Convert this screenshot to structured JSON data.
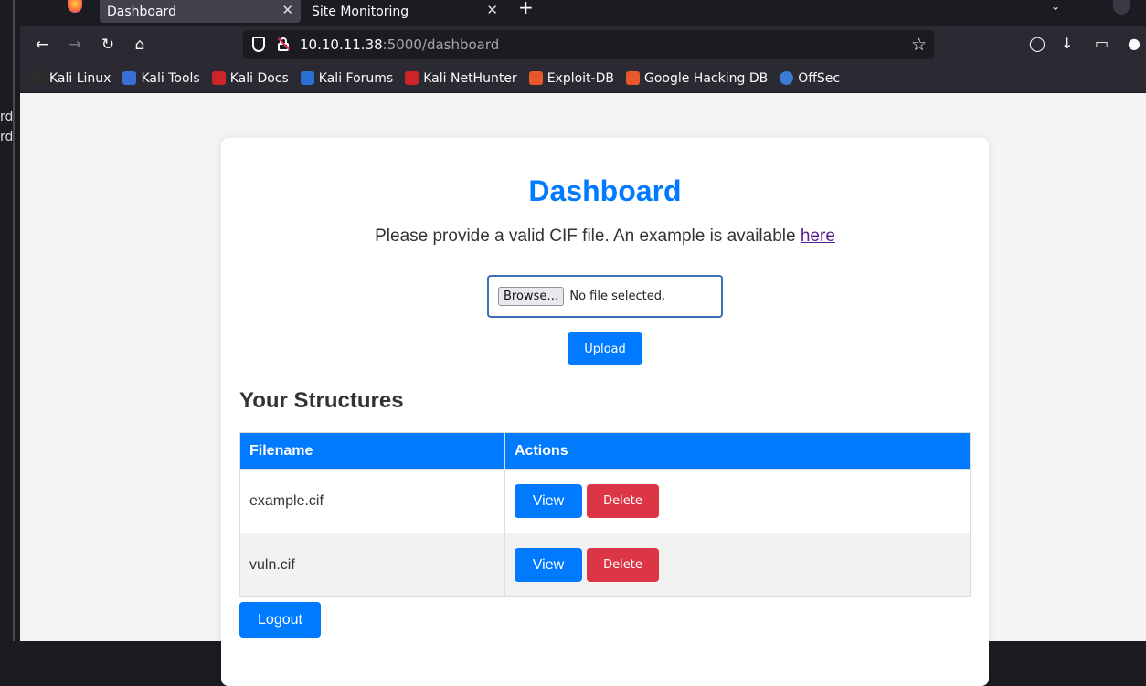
{
  "browser": {
    "tabs": [
      {
        "label": "Dashboard",
        "active": true
      },
      {
        "label": "Site Monitoring",
        "active": false
      }
    ],
    "tab_close_glyph": "✕",
    "new_tab_glyph": "+",
    "url_host": "10.10.11.38",
    "url_rest": ":5000/dashboard",
    "bookmarks": [
      {
        "label": "Kali Linux",
        "color": "#2c2c2c"
      },
      {
        "label": "Kali Tools",
        "color": "#3b6fd8"
      },
      {
        "label": "Kali Docs",
        "color": "#d0242b"
      },
      {
        "label": "Kali Forums",
        "color": "#2a6fd6"
      },
      {
        "label": "Kali NetHunter",
        "color": "#d0242b"
      },
      {
        "label": "Exploit-DB",
        "color": "#e8582a"
      },
      {
        "label": "Google Hacking DB",
        "color": "#e8582a"
      },
      {
        "label": "OffSec",
        "color": "#3a7bd5"
      }
    ]
  },
  "page": {
    "title": "Dashboard",
    "prompt_text": "Please provide a valid CIF file. An example is available ",
    "prompt_link": "here",
    "file_button": "Browse…",
    "file_status": "No file selected.",
    "upload_label": "Upload",
    "section_title": "Your Structures",
    "table": {
      "headers": [
        "Filename",
        "Actions"
      ],
      "rows": [
        {
          "filename": "example.cif",
          "view": "View",
          "delete": "Delete"
        },
        {
          "filename": "vuln.cif",
          "view": "View",
          "delete": "Delete"
        }
      ]
    },
    "logout_label": "Logout"
  },
  "side": {
    "lines": [
      "rd",
      "rd"
    ]
  }
}
